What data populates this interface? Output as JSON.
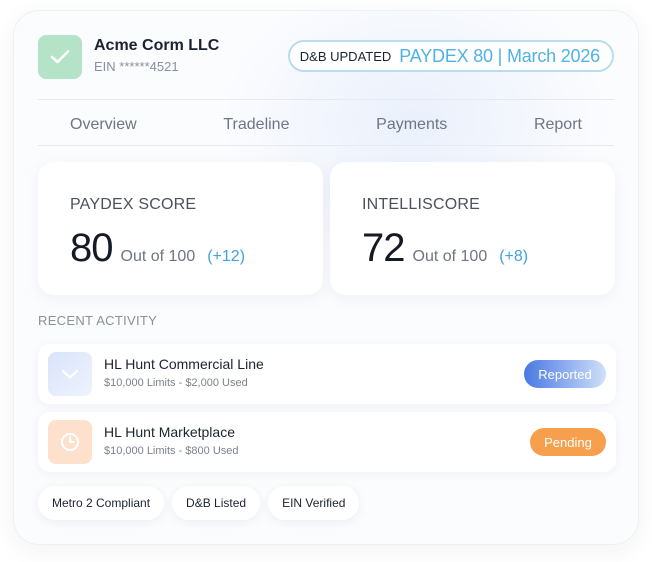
{
  "company": {
    "name": "Acme Corm LLC",
    "ein": "EIN ******4521",
    "icon": "check-icon"
  },
  "status": {
    "label": "D&B UPDATED",
    "value": "PAYDEX 80 | March 2026",
    "accent_color": "#4fb2e6"
  },
  "tabs": [
    {
      "label": "Overview"
    },
    {
      "label": "Tradeline"
    },
    {
      "label": "Payments"
    },
    {
      "label": "Report"
    }
  ],
  "scores": [
    {
      "title": "PAYDEX SCORE",
      "value": "80",
      "out_of": "Out of 100",
      "delta": "(+12)"
    },
    {
      "title": "INTELLISCORE",
      "value": "72",
      "out_of": "Out of 100",
      "delta": "(+8)"
    }
  ],
  "recent_activity": {
    "title": "RECENT ACTIVITY",
    "items": [
      {
        "title": "HL Hunt Commercial Line",
        "subtitle": "$10,000 Limits - $2,000 Used",
        "badge": "Reported",
        "icon": "check-icon"
      },
      {
        "title": "HL Hunt Marketplace",
        "subtitle": "$10,000 Limits - $800 Used",
        "badge": "Pending",
        "icon": "clock-icon"
      }
    ]
  },
  "chips": [
    {
      "label": "Metro 2 Compliant"
    },
    {
      "label": "D&B Listed"
    },
    {
      "label": "EIN Verified"
    }
  ],
  "colors": {
    "success": "#b5e3c8",
    "reported_badge": "#4f7fe6",
    "pending_badge": "#f6a04d"
  }
}
